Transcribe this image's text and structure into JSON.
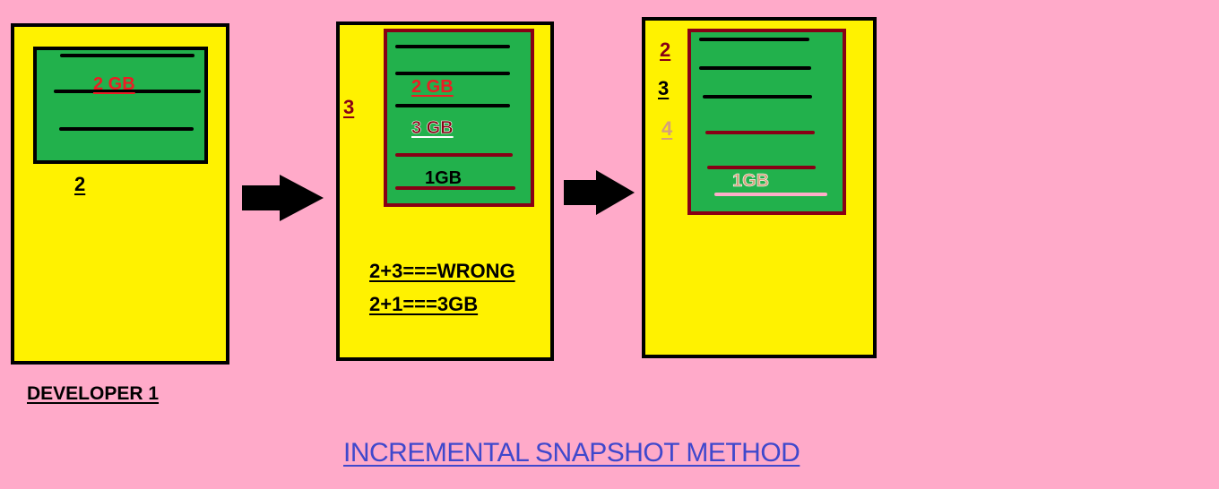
{
  "colors": {
    "background": "#ffaac9",
    "panel": "#fff200",
    "disk": "#22b14c",
    "red_text": "#ed1c24",
    "maroon": "#880015",
    "tan": "#d5a07a",
    "blue_title": "#3f48cc"
  },
  "panel1": {
    "disk_label": "2 GB",
    "snapshot_label": "2",
    "caption": "DEVELOPER 1"
  },
  "panel2": {
    "side_label": "3",
    "disk_label_1": "2 GB",
    "disk_label_2": "3 GB",
    "disk_label_3": "1GB",
    "equation_1": "2+3===WRONG",
    "equation_2": "2+1===3GB"
  },
  "panel3": {
    "side_label_1": "2",
    "side_label_2": "3",
    "side_label_3": "4",
    "disk_label": "1GB"
  },
  "arrows": [
    "arrow-right-icon",
    "arrow-right-icon"
  ],
  "title": "INCREMENTAL SNAPSHOT METHOD"
}
